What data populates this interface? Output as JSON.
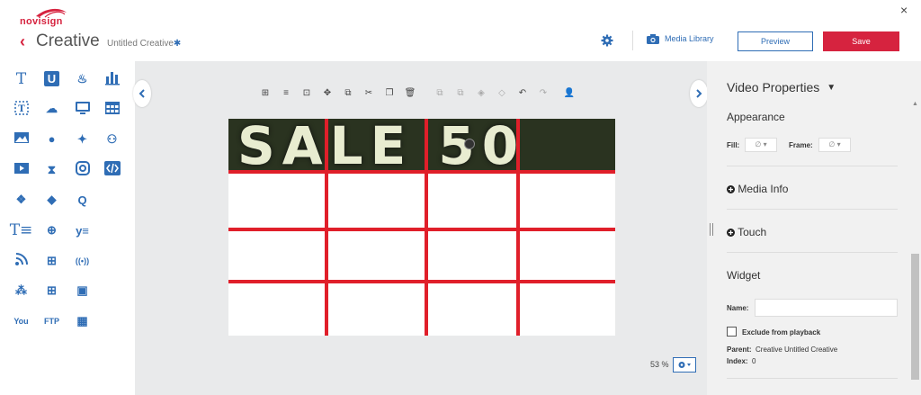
{
  "header": {
    "logo": "novisign",
    "back_icon": "chevron-left-icon",
    "title": "Creative",
    "subtitle": "Untitled Creative",
    "subtitle_mark": "✱",
    "settings_icon": "gear-icon",
    "media_library_label": "Media Library",
    "preview_label": "Preview",
    "save_label": "Save",
    "close_label": "×"
  },
  "tools": {
    "items": [
      {
        "name": "text",
        "icon": "text-icon",
        "glyph": "T"
      },
      {
        "name": "u-widget",
        "icon": "u-box-icon",
        "glyph": "U"
      },
      {
        "name": "rss-hand",
        "icon": "feed-icon",
        "glyph": "♨"
      },
      {
        "name": "chart",
        "icon": "bar-chart-icon",
        "glyph": ""
      },
      {
        "name": "text-box",
        "icon": "text-box-icon",
        "glyph": "T"
      },
      {
        "name": "weather",
        "icon": "weather-icon",
        "glyph": "☁"
      },
      {
        "name": "monitor",
        "icon": "monitor-icon",
        "glyph": ""
      },
      {
        "name": "table",
        "icon": "table-icon",
        "glyph": ""
      },
      {
        "name": "image",
        "icon": "image-icon",
        "glyph": ""
      },
      {
        "name": "clock",
        "icon": "clock-icon",
        "glyph": "●"
      },
      {
        "name": "twitter",
        "icon": "twitter-icon",
        "glyph": "✦"
      },
      {
        "name": "audience",
        "icon": "audience-icon",
        "glyph": "⚇"
      },
      {
        "name": "video",
        "icon": "video-icon",
        "glyph": ""
      },
      {
        "name": "timer",
        "icon": "hourglass-icon",
        "glyph": "⧗"
      },
      {
        "name": "instagram",
        "icon": "instagram-icon",
        "glyph": ""
      },
      {
        "name": "html",
        "icon": "code-icon",
        "glyph": "</>"
      },
      {
        "name": "slides",
        "icon": "slides-icon",
        "glyph": "❖"
      },
      {
        "name": "shapes",
        "icon": "shapes-icon",
        "glyph": "◆"
      },
      {
        "name": "q-widget",
        "icon": "q-icon",
        "glyph": "Q"
      },
      {
        "name": "text-list",
        "icon": "text-list-icon",
        "glyph": "T≡"
      },
      {
        "name": "web",
        "icon": "globe-icon",
        "glyph": "⊕"
      },
      {
        "name": "yammer",
        "icon": "yammer-icon",
        "glyph": "y≡"
      },
      {
        "name": "rss",
        "icon": "rss-icon",
        "glyph": ""
      },
      {
        "name": "web-grid",
        "icon": "web-grid-icon",
        "glyph": "⊞"
      },
      {
        "name": "broadcast",
        "icon": "broadcast-icon",
        "glyph": "((•))"
      },
      {
        "name": "rss-grid",
        "icon": "rss-grid-icon",
        "glyph": "⁂"
      },
      {
        "name": "web-image",
        "icon": "web-image-icon",
        "glyph": "⊞"
      },
      {
        "name": "image-360",
        "icon": "image-360-icon",
        "glyph": "▣"
      },
      {
        "name": "youtube",
        "icon": "youtube-icon",
        "glyph": "You"
      },
      {
        "name": "ftp",
        "icon": "ftp-icon",
        "glyph": "FTP"
      },
      {
        "name": "calendar",
        "icon": "calendar-icon",
        "glyph": "▦"
      }
    ]
  },
  "toolbar": {
    "items": [
      {
        "name": "grid",
        "icon": "grid-icon",
        "glyph": "⊞",
        "dim": false
      },
      {
        "name": "align",
        "icon": "align-icon",
        "glyph": "≡",
        "dim": false
      },
      {
        "name": "fit",
        "icon": "fit-icon",
        "glyph": "⊡",
        "dim": false
      },
      {
        "name": "move",
        "icon": "move-icon",
        "glyph": "✥",
        "dim": false
      },
      {
        "name": "copy-style",
        "icon": "copy-style-icon",
        "glyph": "⧉",
        "dim": false
      },
      {
        "name": "cut",
        "icon": "scissors-icon",
        "glyph": "✂",
        "dim": false
      },
      {
        "name": "paste",
        "icon": "paste-icon",
        "glyph": "❐",
        "dim": false
      },
      {
        "name": "delete",
        "icon": "trash-icon",
        "glyph": "🗑",
        "dim": false
      },
      {
        "name": "bring-front",
        "icon": "bring-front-icon",
        "glyph": "⧉",
        "dim": true
      },
      {
        "name": "send-back",
        "icon": "send-back-icon",
        "glyph": "⧉",
        "dim": true
      },
      {
        "name": "forward",
        "icon": "forward-icon",
        "glyph": "◈",
        "dim": true
      },
      {
        "name": "backward",
        "icon": "backward-icon",
        "glyph": "◇",
        "dim": true
      },
      {
        "name": "undo",
        "icon": "undo-icon",
        "glyph": "↶",
        "dim": false
      },
      {
        "name": "redo",
        "icon": "redo-icon",
        "glyph": "↷",
        "dim": true
      },
      {
        "name": "add-user",
        "icon": "add-user-icon",
        "glyph": "👤",
        "dim": false
      }
    ]
  },
  "canvas": {
    "video_text": "SALE 50",
    "zoom": "53 %",
    "grid_color": "#e01f2a"
  },
  "properties": {
    "title": "Video Properties",
    "appearance": "Appearance",
    "fill_label": "Fill:",
    "fill_value": "∅ ▾",
    "frame_label": "Frame:",
    "frame_value": "∅ ▾",
    "media_info": "Media Info",
    "touch": "Touch",
    "widget": "Widget",
    "name_label": "Name:",
    "name_value": "",
    "exclude_label": "Exclude from playback",
    "parent_label": "Parent:",
    "parent_value": "Creative Untitled Creative",
    "index_label": "Index:",
    "index_value": "0"
  },
  "colors": {
    "accent": "#2f6db5",
    "brand": "#d6233f"
  }
}
